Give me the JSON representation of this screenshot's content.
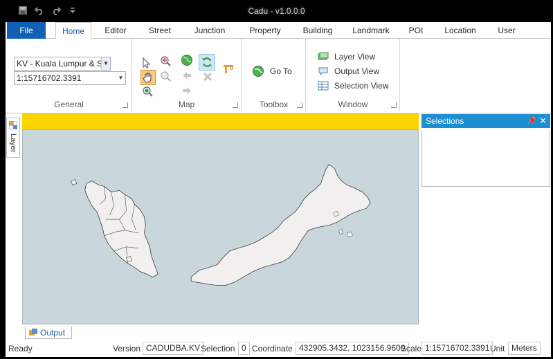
{
  "window": {
    "title": "Cadu - v1.0.0.0"
  },
  "qat": {
    "save_icon": "save-icon",
    "undo_icon": "undo-icon",
    "redo_icon": "redo-icon",
    "customize_icon": "customize-icon"
  },
  "tabs": {
    "file": "File",
    "items": [
      "Home",
      "Editor",
      "Street",
      "Junction",
      "Property",
      "Building",
      "Landmark",
      "POI",
      "Location",
      "User"
    ],
    "active": "Home"
  },
  "ribbon": {
    "general": {
      "label": "General",
      "region_value": "KV - Kuala Lumpur & S",
      "scale_value": "1:15716702.3391"
    },
    "map": {
      "label": "Map"
    },
    "toolbox": {
      "label": "Toolbox",
      "goto_label": "Go To"
    },
    "window": {
      "label": "Window",
      "layer_view": "Layer View",
      "output_view": "Output View",
      "selection_view": "Selection View"
    }
  },
  "side": {
    "layer_tab": "Layer"
  },
  "selections": {
    "title": "Selections"
  },
  "output": {
    "tab_label": "Output"
  },
  "status": {
    "ready": "Ready",
    "version_label": "Version",
    "version_value": "CADUDBA.KV",
    "selection_label": "Selection",
    "selection_value": "0",
    "coordinate_label": "Coordinate",
    "coordinate_value": "432905.3432, 1023156.9600",
    "scale_label": "Scale",
    "scale_value": "1:15716702.3391",
    "unit_label": "Unit",
    "unit_value": "Meters"
  },
  "colors": {
    "accent": "#1160b6",
    "map_banner": "#fcd500",
    "map_sea": "#c9d7dc",
    "land": "#f2f0ee",
    "panel_header": "#1d8ed1"
  }
}
